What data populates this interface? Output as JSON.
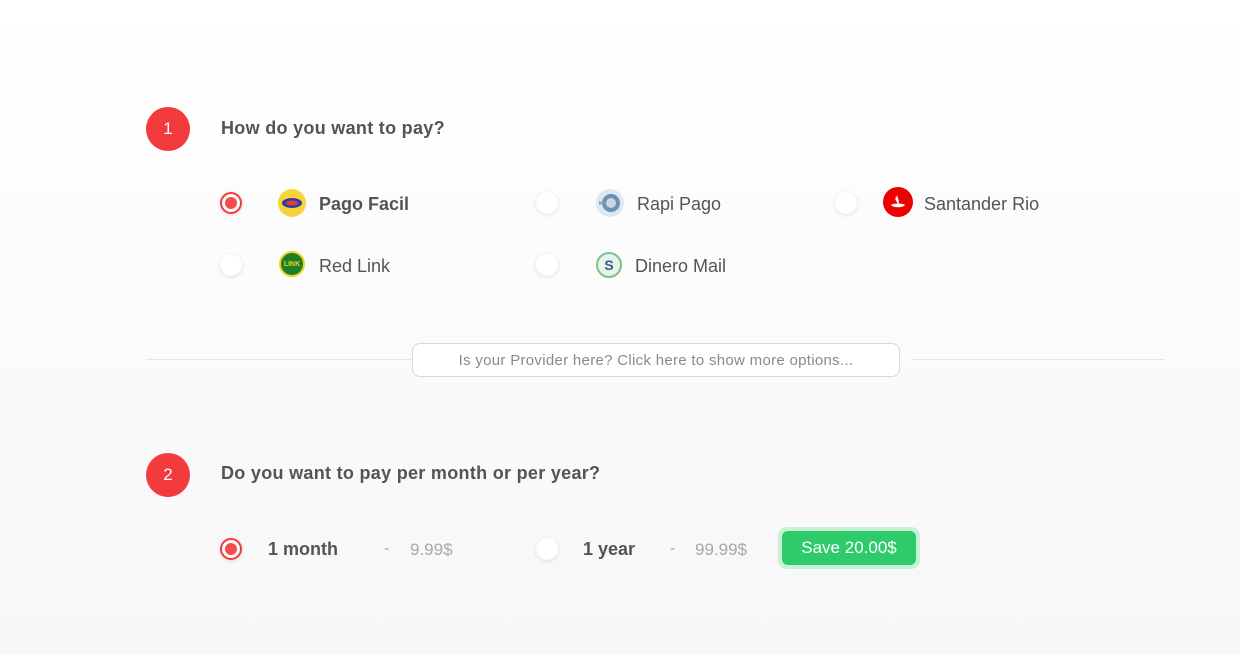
{
  "step1": {
    "number": "1",
    "title": "How do you want to pay?",
    "options": [
      {
        "label": "Pago Facil",
        "icon": "pago-facil-logo-icon",
        "selected": true
      },
      {
        "label": "Rapi Pago",
        "icon": "rapi-pago-logo-icon",
        "selected": false
      },
      {
        "label": "Santander Rio",
        "icon": "santander-logo-icon",
        "selected": false
      },
      {
        "label": "Red Link",
        "icon": "red-link-logo-icon",
        "selected": false
      },
      {
        "label": "Dinero Mail",
        "icon": "dinero-mail-logo-icon",
        "selected": false
      }
    ],
    "red_link_logo_text": "LINK",
    "dinero_mail_logo_text": "S",
    "more_options": "Is your Provider here? Click here to show more options..."
  },
  "step2": {
    "number": "2",
    "title": "Do you want to pay per month or per year?",
    "plans": [
      {
        "label": "1 month",
        "separator": "-",
        "price": "9.99$",
        "selected": true
      },
      {
        "label": "1 year",
        "separator": "-",
        "price": "99.99$",
        "selected": false
      }
    ],
    "save_badge": "Save 20.00$"
  },
  "colors": {
    "accent": "#f33a3d",
    "save_green": "#2ecb6b",
    "santander_red": "#ec0000"
  }
}
